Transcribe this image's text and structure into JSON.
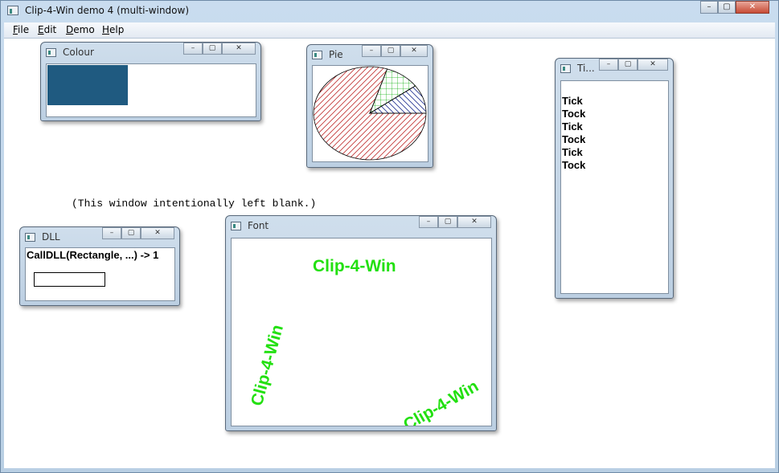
{
  "app": {
    "title": "Clip-4-Win demo 4 (multi-window)",
    "menu": [
      "File",
      "Edit",
      "Demo",
      "Help"
    ],
    "blank_note": "(This window intentionally left blank.)"
  },
  "windows": {
    "colour": {
      "title": "Colour",
      "swatch_color": "#1f5a80"
    },
    "pie": {
      "title": "Pie",
      "slices": [
        {
          "pattern": "diagonal-hatch",
          "color": "#c03030",
          "fraction": 0.8
        },
        {
          "pattern": "crosshatch",
          "color": "#10b010",
          "fraction": 0.1
        },
        {
          "pattern": "backdiagonal-hatch",
          "color": "#203090",
          "fraction": 0.1
        }
      ]
    },
    "ticker": {
      "title": "Ti...",
      "lines": [
        "Tick",
        "Tock",
        "Tick",
        "Tock",
        "Tick",
        "Tock"
      ]
    },
    "dll": {
      "title": "DLL",
      "text": "CallDLL(Rectangle, ...) -> 1"
    },
    "font": {
      "title": "Font",
      "sample_text": "Clip-4-Win",
      "sample_color": "#22e010"
    }
  },
  "controls": {
    "minimize": "–",
    "maximize": "▢",
    "close": "✕"
  }
}
